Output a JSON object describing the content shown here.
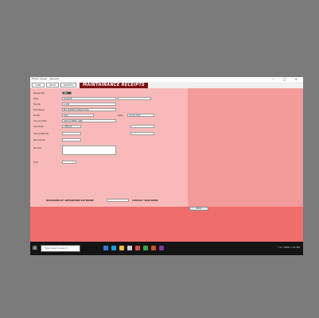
{
  "window": {
    "title": "Photo Viewer - Receipt",
    "controls": "– □ ×",
    "tabs": [
      "HOME",
      "SETUP",
      "RECEIPTS"
    ],
    "app_title": "MAINTAINANCE RECEIPTS"
  },
  "form": {
    "rows": [
      {
        "label": "Receipt No",
        "value": "001"
      },
      {
        "label": "Date",
        "value": "01/2016"
      },
      {
        "label": "Flat No",
        "value": "A 101"
      },
      {
        "label": "Flat Owner",
        "value": "MR SURESH KUMAR PATIL"
      },
      {
        "label": "Month",
        "value": "April"
      },
      {
        "label": "Amount Paid",
        "value": "4500 RUPEES ONLY"
      },
      {
        "label": "Pay Mode",
        "value": "CHEQUE"
      },
      {
        "label": "Cheque/DD No",
        "value": ""
      },
      {
        "label": "Bank Name",
        "value": ""
      },
      {
        "label": "Remark",
        "value": ""
      },
      {
        "label": "Total",
        "value": ""
      }
    ],
    "extra_field_label": "Date",
    "extra_field_value": "01-02-2016",
    "footer_left": "DEVELOPED BY: NETPARTNER SOFTWARE",
    "footer_right": "CONTACT: 9000 00000"
  },
  "grid": {
    "button": "Print"
  },
  "taskbar": {
    "start": "⊞",
    "search_placeholder": "Type here to search",
    "tray": "⌃ ⊡ ♪ ENG  7:21 PM"
  },
  "colors": {
    "form_bg": "#f7b9b9",
    "bottom_bg": "#f06d6d",
    "title_bg": "#7a1216",
    "grid_head": "#0b1d66",
    "grid_selection": "#3f78d8",
    "taskbar": "#141414"
  }
}
